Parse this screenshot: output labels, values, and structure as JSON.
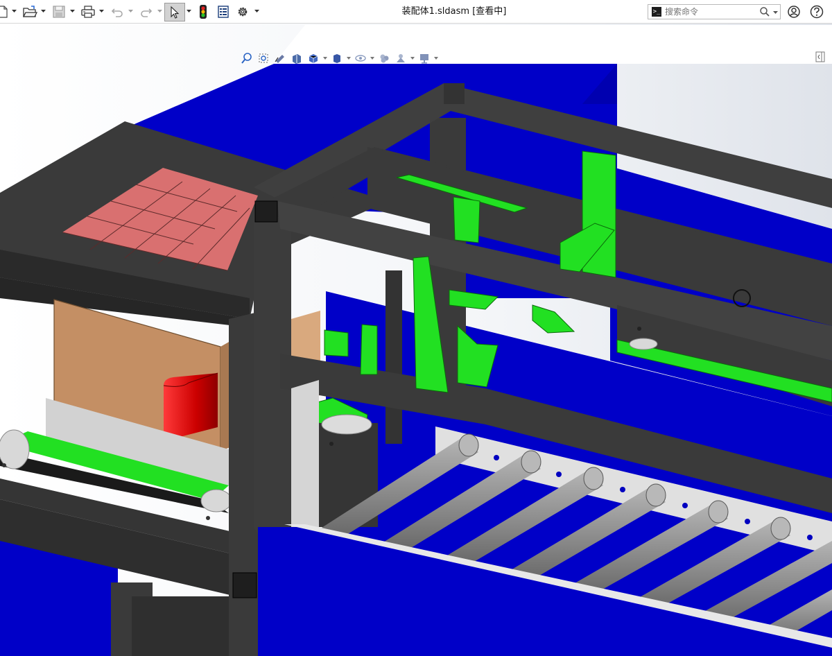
{
  "window": {
    "title": "装配体1.sldasm [查看中]"
  },
  "toolbar": {
    "items": [
      {
        "name": "new-document",
        "icon": "page-icon"
      },
      {
        "name": "open",
        "icon": "folder-icon"
      },
      {
        "name": "save",
        "icon": "floppy-icon"
      },
      {
        "name": "print",
        "icon": "printer-icon"
      },
      {
        "name": "undo",
        "icon": "undo-icon"
      },
      {
        "name": "redo",
        "icon": "redo-icon"
      },
      {
        "name": "select",
        "icon": "cursor-icon"
      },
      {
        "name": "rebuild",
        "icon": "traffic-light-icon"
      },
      {
        "name": "file-properties",
        "icon": "properties-icon"
      },
      {
        "name": "options",
        "icon": "gear-icon"
      }
    ]
  },
  "search": {
    "placeholder": "搜索命令",
    "value": ""
  },
  "colors": {
    "background": "#ffffff",
    "enclosure_blue": "#0000c8",
    "frame_dark": "#3c3c3c",
    "belt_green": "#22e022",
    "box_tan": "#c4936a",
    "grid_pink": "#d77474",
    "roller_gray": "#8e8e8e",
    "red_part": "#e00000"
  },
  "heads_up_toolbar": [
    "zoom-to-fit-icon",
    "zoom-to-area-icon",
    "previous-view-icon",
    "section-view-icon",
    "view-orientation-icon",
    "display-style-icon",
    "hide-show-items-icon",
    "edit-appearance-icon",
    "apply-scene-icon",
    "view-settings-icon"
  ]
}
